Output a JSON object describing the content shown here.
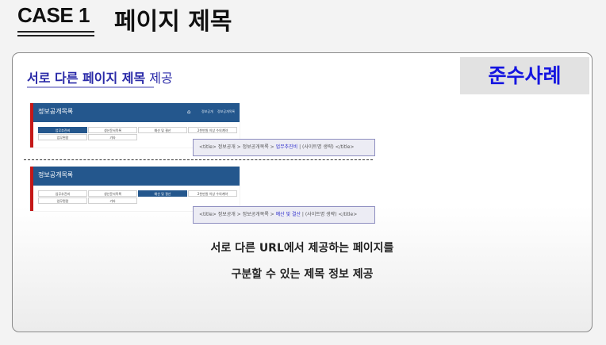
{
  "header": {
    "case_label": "CASE 1",
    "page_heading": "페이지 제목"
  },
  "card": {
    "section_title_bold": "서로 다른 페이지 제목",
    "section_title_normal": " 제공",
    "badge": "준수사례",
    "screenshot1": {
      "title": "정보공개목록",
      "home_icon": "home-icon",
      "crumb1": "정보공개",
      "crumb2": "정보공개목록",
      "tabs": [
        "업무추진비",
        "생산문서목록",
        "예산 및 결산",
        "2천만원 이상 수의계약",
        "업무편람",
        "기타"
      ],
      "active_tab": 0,
      "code_prefix": "<title> 정보공개 > 정보공개목록 > ",
      "code_highlight": "업무추진비",
      "code_suffix": " | (사이트명 생략) </title>"
    },
    "screenshot2": {
      "title": "정보공개목록",
      "tabs": [
        "업무추진비",
        "생산문서목록",
        "예산 및 결산",
        "2천만원 이상 수의계약",
        "업무편람",
        "기타"
      ],
      "active_tab": 2,
      "code_prefix": "<title> 정보공개 > 정보공개목록 > ",
      "code_highlight": "예산 및 결산",
      "code_suffix": " | (사이트명 생략) </title>"
    },
    "description_line1": "서로 다른 URL에서 제공하는 페이지를",
    "description_line2": "구분할 수 있는 제목 정보 제공"
  }
}
